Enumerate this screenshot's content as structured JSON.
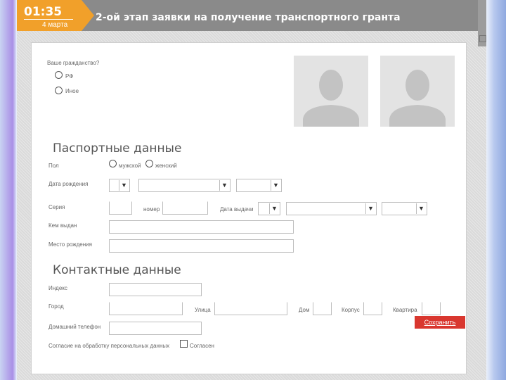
{
  "header": {
    "time": "01:35",
    "date": "4 марта",
    "title": "2-ой этап заявки на получение транспортного гранта"
  },
  "citizenship": {
    "question": "Ваше гражданство?",
    "options": [
      "РФ",
      "Иное"
    ]
  },
  "passport": {
    "title": "Паспортные данные",
    "gender_label": "Пол",
    "gender_options": [
      "мужской",
      "женский"
    ],
    "birth_date_label": "Дата рождения",
    "series_label": "Серия",
    "number_label": "номер",
    "issue_date_label": "Дата выдачи",
    "issued_by_label": "Кем выдан",
    "birth_place_label": "Место рождения"
  },
  "contacts": {
    "title": "Контактные данные",
    "index_label": "Индекс",
    "city_label": "Город",
    "street_label": "Улица",
    "house_label": "Дом",
    "building_label": "Корпус",
    "apartment_label": "Квартира",
    "phone_label": "Домашний телефон",
    "consent_label": "Согласие на обработку персональных данных",
    "consent_checkbox_label": "Согласен"
  },
  "actions": {
    "save_label": "Сохранить"
  },
  "icons": {
    "avatar": "person-placeholder-icon",
    "dropdown": "chevron-down-icon"
  },
  "colors": {
    "accent": "#f1a02a",
    "header_bg": "#8a8a8a",
    "save_button": "#d9372f"
  }
}
